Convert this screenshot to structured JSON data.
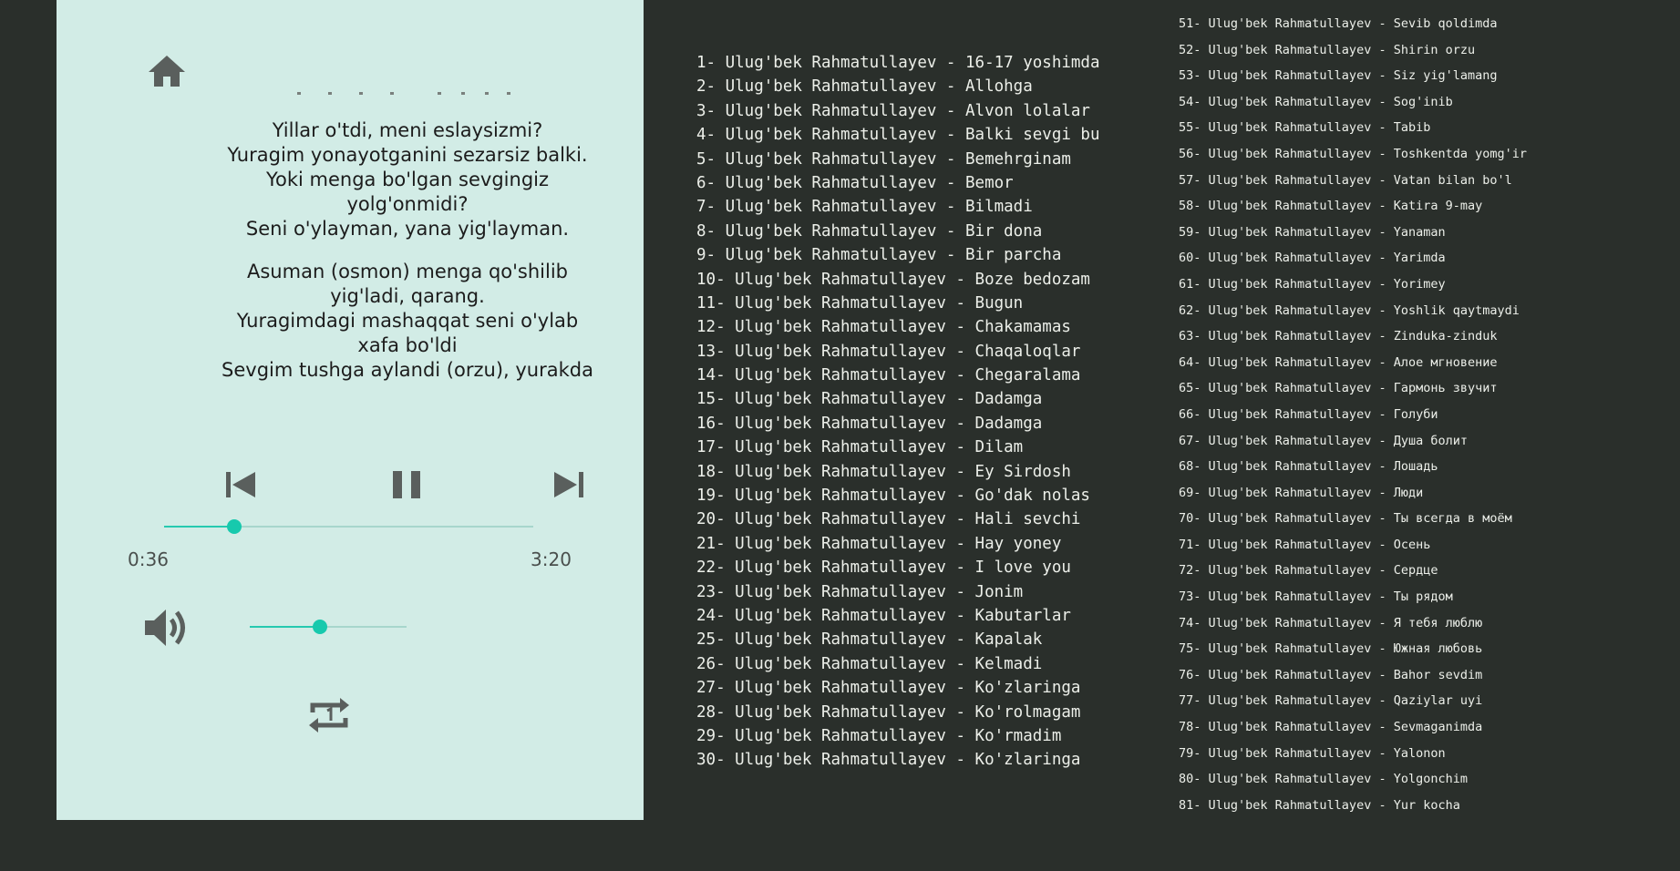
{
  "player": {
    "title": "",
    "lyrics": [
      [
        "Yillar o'tdi, meni eslaysizmi?",
        "Yuragim yonayotganini sezarsiz balki.",
        "Yoki menga bo'lgan sevgingiz",
        "yolg'onmidi?",
        "Seni o'ylayman, yana yig'layman."
      ],
      [
        "Asuman (osmon) menga qo'shilib",
        "yig'ladi, qarang.",
        "Yuragimdagi mashaqqat seni o'ylab",
        "xafa bo'ldi",
        "Sevgim tushga aylandi (orzu), yurakda"
      ]
    ],
    "current_time": "0:36",
    "duration": "3:20",
    "progress": 0.19,
    "volume": 0.45,
    "colors": {
      "panel": "#d2ece6",
      "accent": "#17c9ad",
      "icon": "#5a5f5d"
    },
    "icons": {
      "home": "home-icon",
      "prev": "skip-previous-icon",
      "pause": "pause-icon",
      "next": "skip-next-icon",
      "volume": "volume-icon",
      "repeat": "repeat-one-icon"
    }
  },
  "songs_col1": [
    "1- Ulug'bek Rahmatullayev - 16-17 yoshimda",
    "2- Ulug'bek Rahmatullayev - Allohga",
    "3- Ulug'bek Rahmatullayev - Alvon lolalar",
    "4- Ulug'bek Rahmatullayev - Balki sevgi bu",
    "5- Ulug'bek Rahmatullayev - Bemehrginam",
    "6- Ulug'bek Rahmatullayev - Bemor",
    "7- Ulug'bek Rahmatullayev - Bilmadi",
    "8- Ulug'bek Rahmatullayev - Bir dona",
    "9- Ulug'bek Rahmatullayev - Bir parcha",
    "10- Ulug'bek Rahmatullayev - Boze bedozam",
    "11- Ulug'bek Rahmatullayev - Bugun",
    "12- Ulug'bek Rahmatullayev - Chakamamas",
    "13- Ulug'bek Rahmatullayev - Chaqaloqlar",
    "14- Ulug'bek Rahmatullayev - Chegaralama",
    "15- Ulug'bek Rahmatullayev - Dadamga",
    "16- Ulug'bek Rahmatullayev - Dadamga",
    "17- Ulug'bek Rahmatullayev - Dilam",
    "18- Ulug'bek Rahmatullayev - Ey Sirdosh",
    "19- Ulug'bek Rahmatullayev - Go'dak nolas",
    "20- Ulug'bek Rahmatullayev - Hali sevchi",
    "21- Ulug'bek Rahmatullayev - Hay yoney",
    "22- Ulug'bek Rahmatullayev - I love you",
    "23- Ulug'bek Rahmatullayev - Jonim",
    "24- Ulug'bek Rahmatullayev - Kabutarlar",
    "25- Ulug'bek Rahmatullayev - Kapalak",
    "26- Ulug'bek Rahmatullayev - Kelmadi",
    "27- Ulug'bek Rahmatullayev - Ko'zlaringa",
    "28- Ulug'bek Rahmatullayev - Ko'rolmagam",
    "29- Ulug'bek Rahmatullayev - Ko'rmadim",
    "30- Ulug'bek Rahmatullayev - Ko'zlaringa"
  ],
  "songs_col2": [
    "51- Ulug'bek Rahmatullayev - Sevib qoldimda",
    "52- Ulug'bek Rahmatullayev - Shirin orzu",
    "53- Ulug'bek Rahmatullayev - Siz yig'lamang",
    "54- Ulug'bek Rahmatullayev - Sog'inib",
    "55- Ulug'bek Rahmatullayev - Tabib",
    "56- Ulug'bek Rahmatullayev - Toshkentda yomg'ir",
    "57- Ulug'bek Rahmatullayev - Vatan bilan bo'l",
    "58- Ulug'bek Rahmatullayev - Katira 9-may",
    "59- Ulug'bek Rahmatullayev - Yanaman",
    "60- Ulug'bek Rahmatullayev - Yarimda",
    "61- Ulug'bek Rahmatullayev - Yorimey",
    "62- Ulug'bek Rahmatullayev - Yoshlik qaytmaydi",
    "63- Ulug'bek Rahmatullayev - Zinduka-zinduk",
    "64- Ulug'bek Rahmatullayev - Алое мгновение",
    "65- Ulug'bek Rahmatullayev - Гармонь звучит",
    "66- Ulug'bek Rahmatullayev - Голуби",
    "67- Ulug'bek Rahmatullayev - Душа болит",
    "68- Ulug'bek Rahmatullayev - Лошадь",
    "69- Ulug'bek Rahmatullayev - Люди",
    "70- Ulug'bek Rahmatullayev - Ты всегда в моём",
    "71- Ulug'bek Rahmatullayev - Осень",
    "72- Ulug'bek Rahmatullayev - Сердце",
    "73- Ulug'bek Rahmatullayev - Ты рядом",
    "74- Ulug'bek Rahmatullayev - Я тебя люблю",
    "75- Ulug'bek Rahmatullayev - Южная любовь",
    "76- Ulug'bek Rahmatullayev - Bahor sevdim",
    "77- Ulug'bek Rahmatullayev - Qaziylar uyi",
    "78- Ulug'bek Rahmatullayev - Sevmaganimda",
    "79- Ulug'bek Rahmatullayev - Yalonon",
    "80- Ulug'bek Rahmatullayev - Yolgonchim",
    "81- Ulug'bek Rahmatullayev - Yur kocha"
  ]
}
